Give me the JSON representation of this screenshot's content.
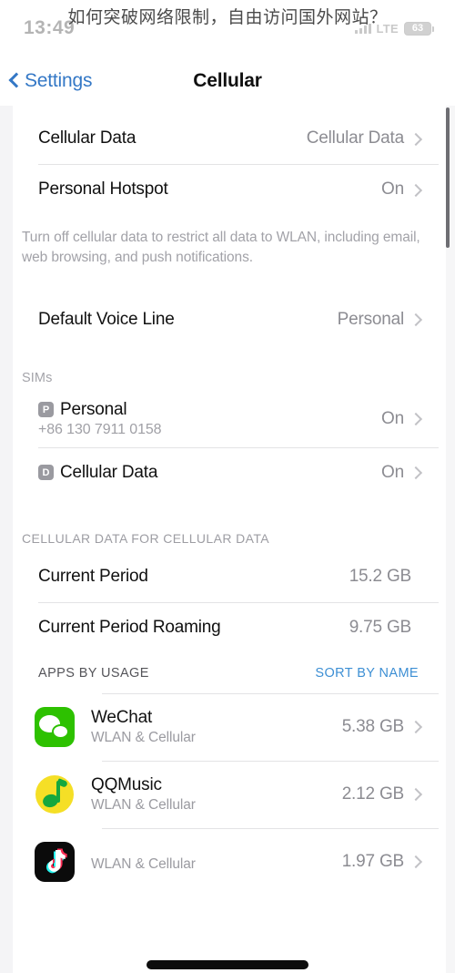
{
  "overlay": {
    "caption": "如何突破网络限制，自由访问国外网站？"
  },
  "status_bar": {
    "time": "13:49",
    "signal_icon": "signal-bars-icon",
    "network_label": "LTE",
    "battery_percent": "63"
  },
  "nav": {
    "back_label": "Settings",
    "back_icon": "chevron-left-icon",
    "title": "Cellular"
  },
  "main": {
    "top_group": {
      "rows": [
        {
          "title": "Cellular Data",
          "value": "Cellular Data",
          "chevron": "chevron-right-icon"
        },
        {
          "title": "Personal Hotspot",
          "value": "On",
          "chevron": "chevron-right-icon"
        }
      ],
      "footer": "Turn off cellular data to restrict all data to WLAN, including email, web browsing, and push notifications."
    },
    "voice_group": {
      "rows": [
        {
          "title": "Default Voice Line",
          "value": "Personal",
          "chevron": "chevron-right-icon"
        }
      ]
    },
    "sims_group": {
      "header": "SIMs",
      "rows": [
        {
          "badge": "P",
          "name": "Personal",
          "number": "+86 130 7911 0158",
          "value": "On",
          "chevron": "chevron-right-icon"
        },
        {
          "badge": "D",
          "name": "Cellular Data",
          "number": "",
          "value": "On",
          "chevron": "chevron-right-icon"
        }
      ]
    },
    "usage_group": {
      "header": "CELLULAR DATA FOR CELLULAR DATA",
      "rows": [
        {
          "title": "Current Period",
          "value": "15.2 GB"
        },
        {
          "title": "Current Period Roaming",
          "value": "9.75 GB"
        }
      ]
    },
    "apps_group": {
      "header": "APPS BY USAGE",
      "sort_action": "SORT BY NAME",
      "apps": [
        {
          "icon": "wechat-icon",
          "name": "WeChat",
          "subtitle": "WLAN & Cellular",
          "usage": "5.38 GB",
          "chevron": "chevron-right-icon"
        },
        {
          "icon": "qqmusic-icon",
          "name": "QQMusic",
          "subtitle": "WLAN & Cellular",
          "usage": "2.12 GB",
          "chevron": "chevron-right-icon"
        },
        {
          "icon": "tiktok-icon",
          "name": "",
          "subtitle": "WLAN & Cellular",
          "usage": "1.97 GB",
          "chevron": "chevron-right-icon"
        }
      ]
    }
  },
  "colors": {
    "accent_blue": "#3478c6",
    "link_blue": "#3d8fd4",
    "value_gray": "#8c8c92",
    "wechat_green": "#2dc100",
    "qqmusic_yellow": "#f5df26"
  }
}
